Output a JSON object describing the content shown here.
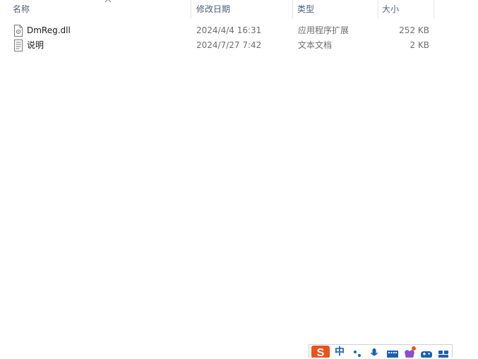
{
  "columns": {
    "name": "名称",
    "modified": "修改日期",
    "type": "类型",
    "size": "大小"
  },
  "files": [
    {
      "name": "DmReg.dll",
      "modified": "2024/4/4 16:31",
      "type": "应用程序扩展",
      "size": "252 KB",
      "icon": "dll-file-icon"
    },
    {
      "name": "说明",
      "modified": "2024/7/27 7:42",
      "type": "文本文档",
      "size": "2 KB",
      "icon": "text-file-icon"
    }
  ],
  "ime_toolbar": {
    "mode": "中",
    "brand_color": "#e8541c",
    "icons": [
      "sogou-logo-icon",
      "punctuation-icon",
      "microphone-icon",
      "keyboard-icon",
      "skin-icon",
      "gamepad-icon",
      "toolbox-icon"
    ]
  }
}
